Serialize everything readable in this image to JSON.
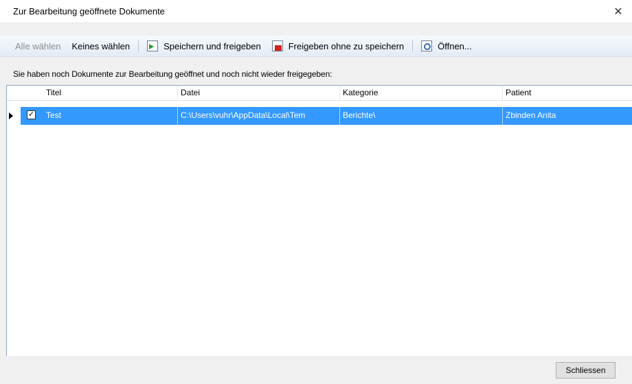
{
  "window": {
    "title": "Zur Bearbeitung geöffnete Dokumente",
    "close": "✕"
  },
  "toolbar": {
    "select_all": "Alle wählen",
    "select_none": "Keines wählen",
    "save_release": "Speichern und freigeben",
    "release_nosave": "Freigeben ohne zu speichern",
    "open": "Öffnen..."
  },
  "info": "Sie haben noch Dokumente zur Bearbeitung geöffnet und noch nicht wieder freigegeben:",
  "grid": {
    "columns": [
      "Titel",
      "Datei",
      "Kategorie",
      "Patient"
    ],
    "rows": [
      {
        "checked": true,
        "check_glyph": "✓",
        "title": "Test",
        "file": "C:\\Users\\vuhr\\AppData\\Local\\Tem",
        "category": "Berichte\\",
        "patient": "Zbinden Anita"
      }
    ]
  },
  "footer": {
    "close_button": "Schliessen"
  },
  "colors": {
    "selection": "#3399ff",
    "titlebar": "#ffffff",
    "toolbar": "#e3ebf6"
  }
}
